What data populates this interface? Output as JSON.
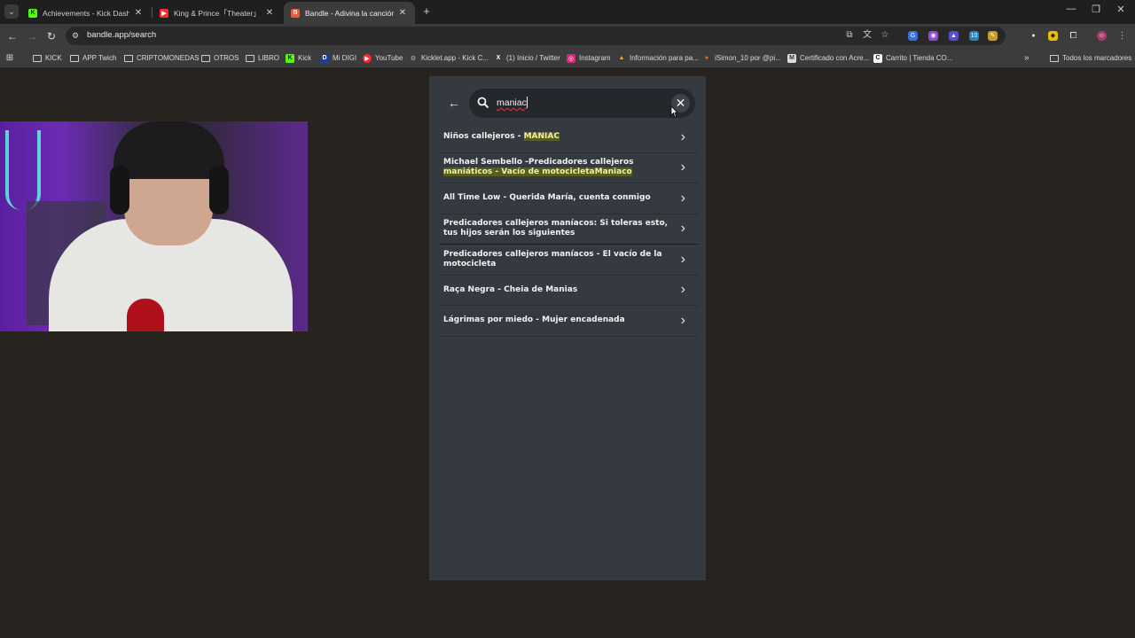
{
  "browser": {
    "tabs": [
      {
        "title": "Achievements - Kick Dashboard",
        "favicon": "K",
        "color": "#53fc18"
      },
      {
        "title": "King & Prince「Theater」MV - Yo",
        "favicon": "▶",
        "color": "#ff2a2a"
      },
      {
        "title": "Bandle - Adivina la canción, ur",
        "favicon": "B",
        "color": "#e85a3c"
      }
    ],
    "new_tab_icon": "plus-icon",
    "window_controls": [
      "—",
      "❐",
      "✕"
    ],
    "url": "bandle.app/search",
    "bookmarks": [
      {
        "label": "KICK",
        "icon": "folder-icon"
      },
      {
        "label": "APP Twich",
        "icon": "folder-icon"
      },
      {
        "label": "CRIPTOMONEDAS",
        "icon": "folder-icon"
      },
      {
        "label": "OTROS",
        "icon": "folder-icon"
      },
      {
        "label": "LIBRO",
        "icon": "folder-icon"
      },
      {
        "label": "Kick",
        "icon": "K"
      },
      {
        "label": "Mi DIGI",
        "icon": "D"
      },
      {
        "label": "YouTube",
        "icon": "▶"
      },
      {
        "label": "Kicklet.app - Kick C...",
        "icon": "⚙"
      },
      {
        "label": "(1) Inicio / Twitter",
        "icon": "X"
      },
      {
        "label": "Instagram",
        "icon": "◎"
      },
      {
        "label": "Información para pa...",
        "icon": "▲"
      },
      {
        "label": "iSimon_10 por @pi...",
        "icon": "●"
      },
      {
        "label": "Certificado con Acre...",
        "icon": "M"
      },
      {
        "label": "Carrito | Tienda CO...",
        "icon": "C"
      }
    ],
    "bookmarks_more": "»",
    "all_bookmarks": "Todos los marcadores"
  },
  "search": {
    "query": "maniac",
    "results": [
      {
        "parts": [
          {
            "t": "Niños callejeros - "
          },
          {
            "t": "MANIAC",
            "hl": true
          }
        ]
      },
      {
        "parts": [
          {
            "t": "Michael Sembello -Predicadores callejeros "
          },
          {
            "t": "maniáticos - Vacío de motocicletaManiaco",
            "hl": true
          }
        ]
      },
      {
        "parts": [
          {
            "t": "All Time Low - Querida María, cuenta conmigo"
          }
        ]
      },
      {
        "parts": [
          {
            "t": "Predicadores callejeros maníacos: Si toleras esto, tus hijos serán los siguientes"
          }
        ]
      },
      {
        "parts": [
          {
            "t": "Predicadores callejeros maníacos - El vacío de la motocicleta"
          }
        ]
      },
      {
        "parts": [
          {
            "t": "Raça Negra - Cheia de Manias"
          }
        ]
      },
      {
        "parts": [
          {
            "t": "Lágrimas por miedo - Mujer encadenada"
          }
        ]
      }
    ]
  }
}
